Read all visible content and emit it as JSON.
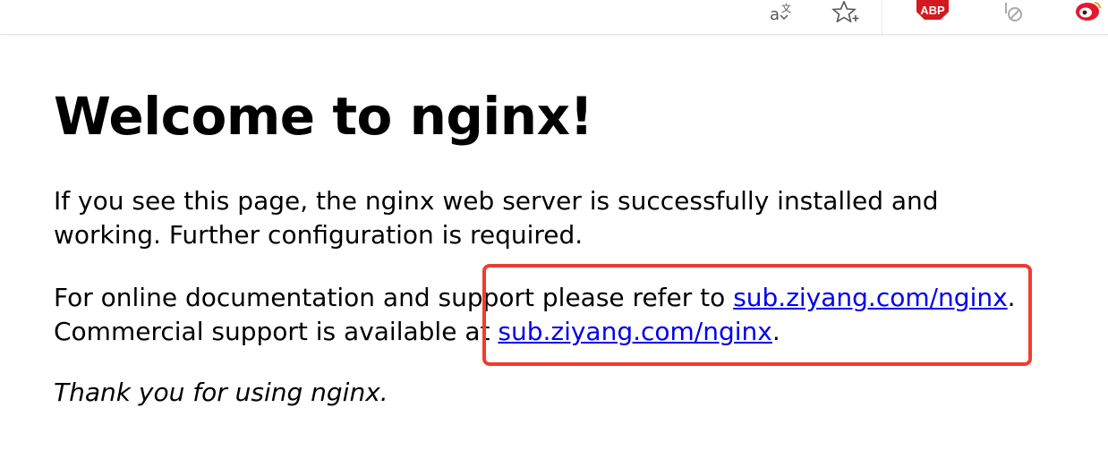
{
  "toolbar": {
    "icons": [
      "translate-icon",
      "bookmark-star-icon",
      "adblock-plus-icon",
      "script-block-icon",
      "weibo-icon"
    ],
    "abp_label": "ABP",
    "abp_color": "#d3181f"
  },
  "page": {
    "heading": "Welcome to nginx!",
    "para1": "If you see this page, the nginx web server is successfully installed and working. Further configuration is required.",
    "para2_prefix": "For online documentation and support please refer to ",
    "para2_link": "sub.ziyang.com/nginx",
    "para2_suffix": ".",
    "para3_prefix": "Commercial support is available at ",
    "para3_link": "sub.ziyang.com/nginx",
    "para3_suffix": ".",
    "thanks": "Thank you for using nginx."
  },
  "colors": {
    "link": "#0000ee",
    "highlight_border": "#f03c2e"
  }
}
